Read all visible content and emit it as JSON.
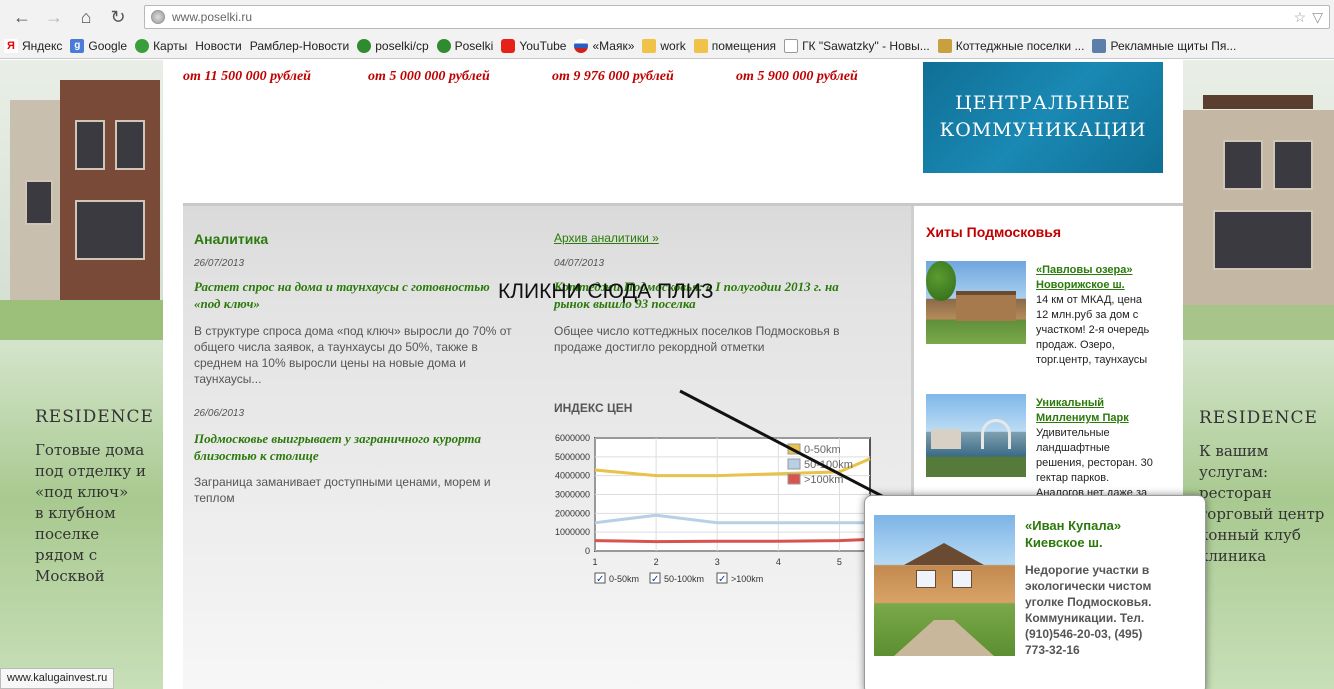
{
  "browser": {
    "url": "www.poselki.ru",
    "back_label": "←",
    "forward_label": "→",
    "home_label": "⌂",
    "reload_label": "↻",
    "bookmarks": [
      {
        "label": "Яндекс",
        "icon": "yandex-icon"
      },
      {
        "label": "Google",
        "icon": "google-icon"
      },
      {
        "label": "Карты",
        "icon": "maps-icon"
      },
      {
        "label": "Новости",
        "icon": "page-icon"
      },
      {
        "label": "Рамблер-Новости",
        "icon": "page-icon"
      },
      {
        "label": "poselki/cp",
        "icon": "gear-icon"
      },
      {
        "label": "Poselki",
        "icon": "gear-icon"
      },
      {
        "label": "YouTube",
        "icon": "youtube-icon"
      },
      {
        "label": "«Маяк»",
        "icon": "flag-icon"
      },
      {
        "label": "work",
        "icon": "folder-icon"
      },
      {
        "label": "помещения",
        "icon": "folder-icon"
      },
      {
        "label": "ГК \"Sawatzky\" - Новы...",
        "icon": "doc-icon"
      },
      {
        "label": "Коттеджные поселки ...",
        "icon": "house-icon"
      },
      {
        "label": "Рекламные щиты Пя...",
        "icon": "pin-icon"
      }
    ],
    "status_url": "www.kalugainvest.ru"
  },
  "prices": [
    "от 11 500 000 рублей",
    "от 5 000 000 рублей",
    "от 9 976 000 рублей",
    "от 5 900 000 рублей"
  ],
  "banner": {
    "line1": "ЦЕНТРАЛЬНЫЕ",
    "line2": "КОММУНИКАЦИИ"
  },
  "left_ad": {
    "title": "RESIDENCE",
    "lines": [
      "Готовые дома",
      "под отделку и",
      "«под ключ»",
      "в клубном",
      "поселке",
      "рядом с",
      "Москвой"
    ]
  },
  "right_ad": {
    "title": "RESIDENCE",
    "lines": [
      "К вашим",
      "услугам:",
      "ресторан",
      "торговый центр",
      "конный клуб",
      "клиника"
    ]
  },
  "analytics": {
    "title": "Аналитика",
    "archive_link": "Архив аналитики »",
    "articles": [
      {
        "date": "26/07/2013",
        "headline_1": "Растет спрос на дома и таунхаусы с готовностью",
        "headline_2": "«под ключ»",
        "teaser_1": "В структуре спроса дома «под ключ» выросли до 70% от",
        "teaser_2": "общего числа заявок, а таунхаусы до 50%, также в",
        "teaser_3": "среднем на 10% выросли цены на новые дома и",
        "teaser_4": "таунхаусы..."
      },
      {
        "date": "04/07/2013",
        "headline_1": "Коттеджи Подмосковья: в I полугодии 2013 г. на",
        "headline_2": "рынок вышло 93 поселка",
        "teaser_1": "Общее число коттеджных поселков Подмосковья в",
        "teaser_2": "продаже достигло рекордной отметки"
      },
      {
        "date": "26/06/2013",
        "headline_1": "Подмосковье выигрывает у заграничного курорта",
        "headline_2": "близостью к столице",
        "teaser_1": "Заграница заманивает доступными ценами, морем и",
        "teaser_2": "теплом"
      }
    ]
  },
  "price_index": {
    "title": "ИНДЕКС ЦЕН",
    "checkboxes": [
      "0-50km",
      "50-100km",
      ">100km"
    ]
  },
  "chart_data": {
    "type": "line",
    "title": "",
    "x": [
      1,
      2,
      3,
      4,
      5,
      6
    ],
    "ylim": [
      0,
      6000000
    ],
    "yticks": [
      "6000000",
      "5000000",
      "4000000",
      "3000000",
      "2000000",
      "1000000",
      "0"
    ],
    "xticks": [
      "1",
      "2",
      "3",
      "4",
      "5"
    ],
    "legend_position": "top-right",
    "grid": true,
    "series": [
      {
        "name": "0-50km",
        "color": "#e8c24a",
        "values": [
          4300000,
          4000000,
          4000000,
          4100000,
          4200000,
          4900000
        ]
      },
      {
        "name": "50-100km",
        "color": "#b8cfe6",
        "values": [
          1500000,
          1900000,
          1500000,
          1500000,
          1500000,
          1500000
        ]
      },
      {
        "name": ">100km",
        "color": "#d9534f",
        "values": [
          550000,
          500000,
          520000,
          520000,
          550000,
          620000
        ]
      }
    ]
  },
  "hits": {
    "title": "Хиты Подмосковья",
    "items": [
      {
        "link_1": "«Павловы озера»",
        "link_2": "Новорижское ш.",
        "desc_1": "14 км от МКАД, цена",
        "desc_2": "12 млн.руб за дом с",
        "desc_3": "участком! 2-я очередь",
        "desc_4": "продаж. Озеро,",
        "desc_5": "торг.центр, таунхаусы"
      },
      {
        "link_1": "Уникальный",
        "link_2": "Миллениум Парк",
        "desc_1": "Удивительные",
        "desc_2": "ландшафтные",
        "desc_3": "решения, ресторан. 30",
        "desc_4": "гектар парков.",
        "desc_5": "Аналогов нет даже за"
      }
    ]
  },
  "annotation": "КЛИКНИ СЮДА ПЛИЗ",
  "popup": {
    "title_1": "«Иван Купала»",
    "title_2": "Киевское ш.",
    "desc_1": "Недорогие участки в",
    "desc_2": "экологически чистом",
    "desc_3": "уголке Подмосковья.",
    "desc_4": "Коммуникации. Тел.",
    "desc_5": "(910)546-20-03, (495)",
    "desc_6": "773-32-16"
  }
}
